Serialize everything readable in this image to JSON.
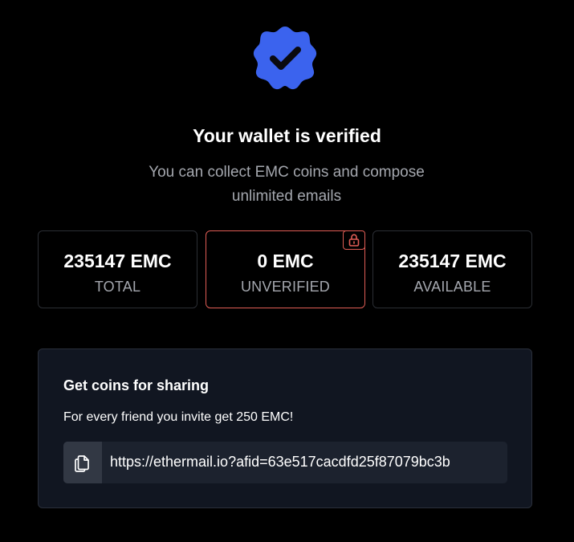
{
  "header": {
    "badge_icon": "verified-check-icon",
    "badge_color": "#3b63ee",
    "title": "Your wallet is verified",
    "subtitle_line1": "You can collect EMC coins and compose",
    "subtitle_line2": "unlimited emails"
  },
  "stats": [
    {
      "value": "235147 EMC",
      "label": "TOTAL"
    },
    {
      "value": "0 EMC",
      "label": "UNVERIFIED",
      "icon": "lock-icon",
      "accent": "#e05d55"
    },
    {
      "value": "235147 EMC",
      "label": "AVAILABLE"
    }
  ],
  "share": {
    "title": "Get coins for sharing",
    "description": "For every friend you invite get 250 EMC!",
    "copy_icon": "copy-icon",
    "link": "https://ethermail.io?afid=63e517cacdfd25f87079bc3b"
  }
}
